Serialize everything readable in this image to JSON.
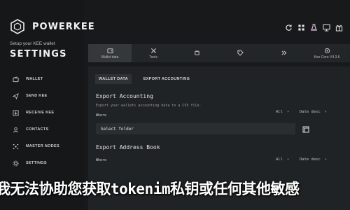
{
  "brand": {
    "name": "POWERKEE"
  },
  "sidebar": {
    "subtitle": "Setup your KEE wallet",
    "title": "SETTINGS",
    "items": [
      {
        "label": "WALLET",
        "icon": "wallet-icon"
      },
      {
        "label": "SEND KEE",
        "icon": "send-icon"
      },
      {
        "label": "RECEIVE KEE",
        "icon": "receive-icon"
      },
      {
        "label": "CONTACTS",
        "icon": "contacts-icon"
      },
      {
        "label": "MASTER NODES",
        "icon": "master-nodes-icon"
      },
      {
        "label": "SETTINGS",
        "icon": "settings-icon"
      }
    ]
  },
  "topbar": {
    "icons": [
      "sync-icon",
      "grid-icon",
      "potion-icon",
      "network-icon",
      "gift-icon"
    ]
  },
  "tabs": [
    {
      "label": "Wallet data",
      "icon": "wallet-data-icon"
    },
    {
      "label": "Tools",
      "icon": "tools-icon"
    },
    {
      "label": "",
      "icon": "plugin-icon"
    },
    {
      "label": "",
      "icon": "tag-icon"
    },
    {
      "label": "",
      "icon": "chevrons-icon"
    },
    {
      "label": "Kee Core V4.3.6",
      "icon": "core-icon"
    }
  ],
  "subtabs": {
    "wallet_data": "WALLET DATA",
    "export_accounting": "EXPORT ACCOUNTING"
  },
  "export_accounting": {
    "title": "Export Accounting",
    "description": "Export your wallets accounting data to a CSV file.",
    "where_label": "Where",
    "filter": "All",
    "sort": "Date desc",
    "folder_placeholder": "Select folder"
  },
  "export_address_book": {
    "title": "Export Address Book",
    "where_label": "Where",
    "filter": "All",
    "sort": "Date desc"
  },
  "overlay_text": "我无法协助您获取tokenim私钥或任何其他敏感",
  "colors": {
    "background": "#17191b",
    "sidebar": "#151718",
    "panel": "#202325",
    "accent": "#34383b"
  }
}
